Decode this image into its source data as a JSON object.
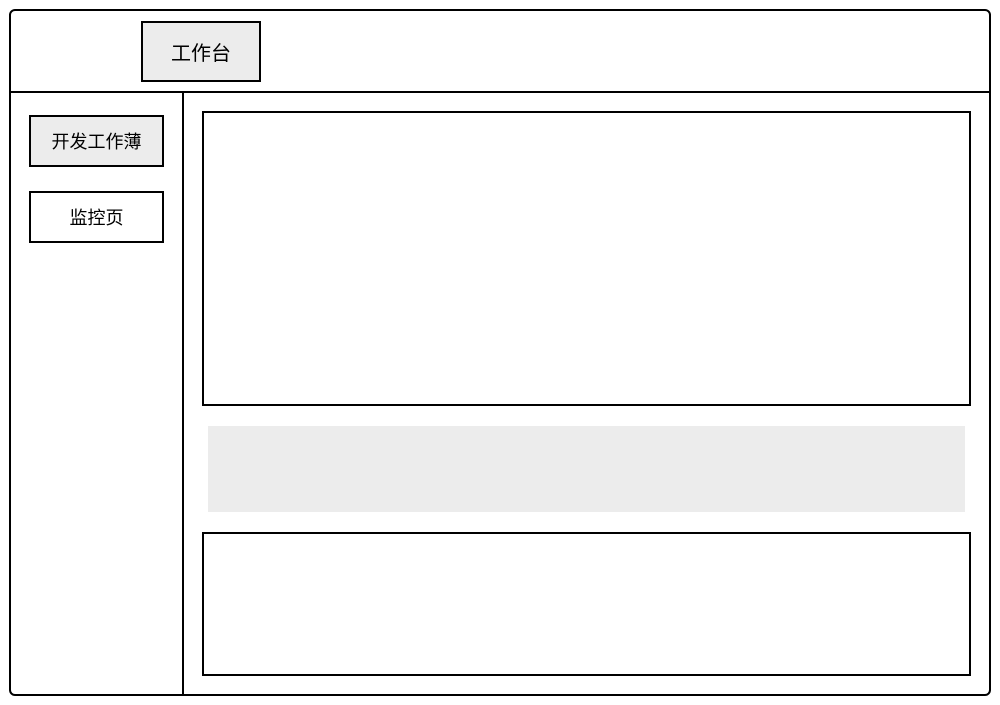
{
  "header": {
    "tab_label": "工作台"
  },
  "sidebar": {
    "items": [
      {
        "label": "开发工作薄",
        "selected": true
      },
      {
        "label": "监控页",
        "selected": false
      }
    ]
  }
}
